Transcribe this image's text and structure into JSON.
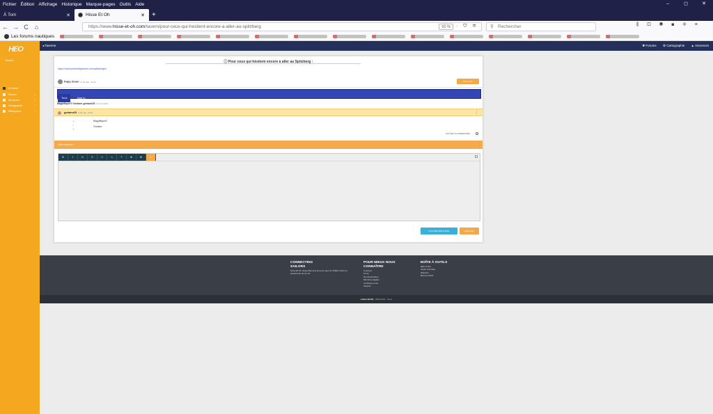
{
  "menu": [
    "Fichier",
    "Édition",
    "Affichage",
    "Historique",
    "Marque-pages",
    "Outils",
    "Aide"
  ],
  "window_controls": [
    "–",
    "◻",
    "✕"
  ],
  "tabs": [
    {
      "label": "À Tom",
      "close": "✕"
    },
    {
      "label": "Hisse Et Oh",
      "close": "✕"
    }
  ],
  "newtab": "+",
  "nav": {
    "back": "←",
    "forward": "→",
    "reload": "C",
    "home": "⌂"
  },
  "url": {
    "prefix": "https://www.",
    "host": "hisse-et-oh.com",
    "path": "/tavern/pour-ceux-qui-hesitent-encore-a-aller-au-spitzberg",
    "zoom": "50 %",
    "icons": "··· ⛉ ☆"
  },
  "search": {
    "placeholder": "Rechercher",
    "icon": "⚲"
  },
  "right_icons": "⫼ ◫ ◉ ◼ ◈ ≡",
  "bookmarks": {
    "first": "Les forums nautiques"
  },
  "site": {
    "breadcrumb": "◂ Taverne",
    "right": [
      "✱ Forums",
      "⚙ Cartographie",
      "▲ Annonces"
    ]
  },
  "sidebar": {
    "logo": "HEO",
    "label": "Taverne",
    "items": [
      {
        "label": "Le forum"
      },
      {
        "label": "Forums"
      },
      {
        "label": "Annonces"
      },
      {
        "label": "Cartographie"
      },
      {
        "label": "Hébergeurs"
      }
    ]
  },
  "post": {
    "title": "Pour ceux qui hésitent encore à aller au Spitzberg :",
    "link": "https://www.worldwildplaces.com/spitsbergen",
    "author": "Papy Zoom",
    "date": "le 15 mai · 11:43",
    "reply_button": "Répondre",
    "tabs": [
      "Tous",
      "Non lu"
    ],
    "summary_author": "Magnifique!!! Gorlann",
    "summary_name": "gorlann25",
    "summary_date": "le 23 mai 2021",
    "comment": {
      "author": "gorlann25",
      "date": "le 23 mai · 10:01",
      "menu": "⋮",
      "lines": [
        "Magnifique!!!",
        "Gorlann"
      ],
      "votes": [
        "▲",
        "0",
        "▼"
      ],
      "footer": "AJOUTER UN COMMENTAIRE"
    },
    "reply_header": "Votre réponse",
    "toolbar": [
      "B",
      "I",
      "U",
      "✎",
      "≡",
      "≡",
      "❝",
      "⊕",
      "⊞",
      "☺"
    ],
    "notify_button": "✉ SUIVRE PAR E-MAIL",
    "submit_button": "Répondre"
  },
  "footer": {
    "col1": {
      "title": "CONNECTING SAILORS",
      "text": "Hisse Et Oh rassemble tous les jours plus de 10000 marins et passionnés de la mer."
    },
    "col2": {
      "title": "POUR MIEUX NOUS CONNAÎTRE",
      "items": [
        "À propos",
        "F.A.Q.",
        "Nos Partenaires",
        "Mentions légales",
        "Contactez-nous",
        "Support"
      ]
    },
    "col3": {
      "title": "BOÎTE À OUTILS",
      "items": [
        "HEO Ordre",
        "Guide Unionbat",
        "Webcam",
        "Bonnes HiSO"
      ]
    },
    "bottom_brand": "Listes Hé Oh",
    "bottom_text": " · 2006-2021 · Nous"
  }
}
